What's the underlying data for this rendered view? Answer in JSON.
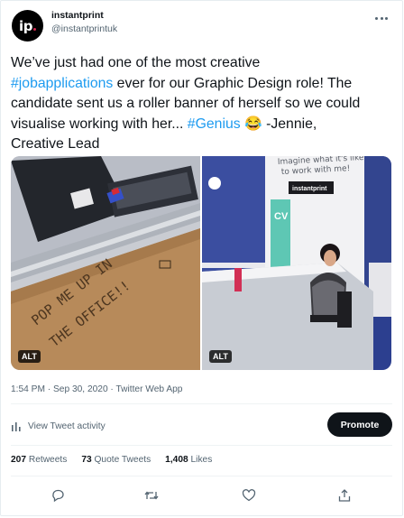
{
  "author": {
    "avatar_text": "ip",
    "display_name": "instantprint",
    "handle": "@instantprintuk"
  },
  "tweet": {
    "line1": "We’ve just had one of the most creative",
    "hashtag1": "#jobapplications",
    "line2_rest": " ever for our Graphic Design role! The",
    "line3": "candidate sent us a roller banner of herself so we could",
    "line4_start": "visualise working with her... ",
    "hashtag2": "#Genius",
    "emoji": "😂",
    "line4_end": " -Jennie,",
    "line5": "Creative Lead"
  },
  "media": {
    "photo1_alt": "ALT",
    "photo2_alt": "ALT",
    "box_text_line1": "POP ME UP IN",
    "box_text_line2": "THE OFFICE!!",
    "banner_text_line1": "Imagine what it's like",
    "banner_text_line2": "to work with me!",
    "banner_logo": "instantprint",
    "banner_cv": "CV"
  },
  "meta": {
    "timestamp": "1:54 PM · Sep 30, 2020 · Twitter Web App"
  },
  "activity": {
    "label": "View Tweet activity",
    "promote_label": "Promote"
  },
  "stats": {
    "retweets_count": "207",
    "retweets_label": "Retweets",
    "quotes_count": "73",
    "quotes_label": "Quote Tweets",
    "likes_count": "1,408",
    "likes_label": "Likes"
  },
  "actions": {
    "icons": [
      "reply-icon",
      "retweet-icon",
      "like-icon",
      "share-icon"
    ]
  },
  "colors": {
    "link": "#1d9bf0",
    "text": "#0f1419",
    "secondary": "#536471",
    "promote_bg": "#0f1419"
  }
}
